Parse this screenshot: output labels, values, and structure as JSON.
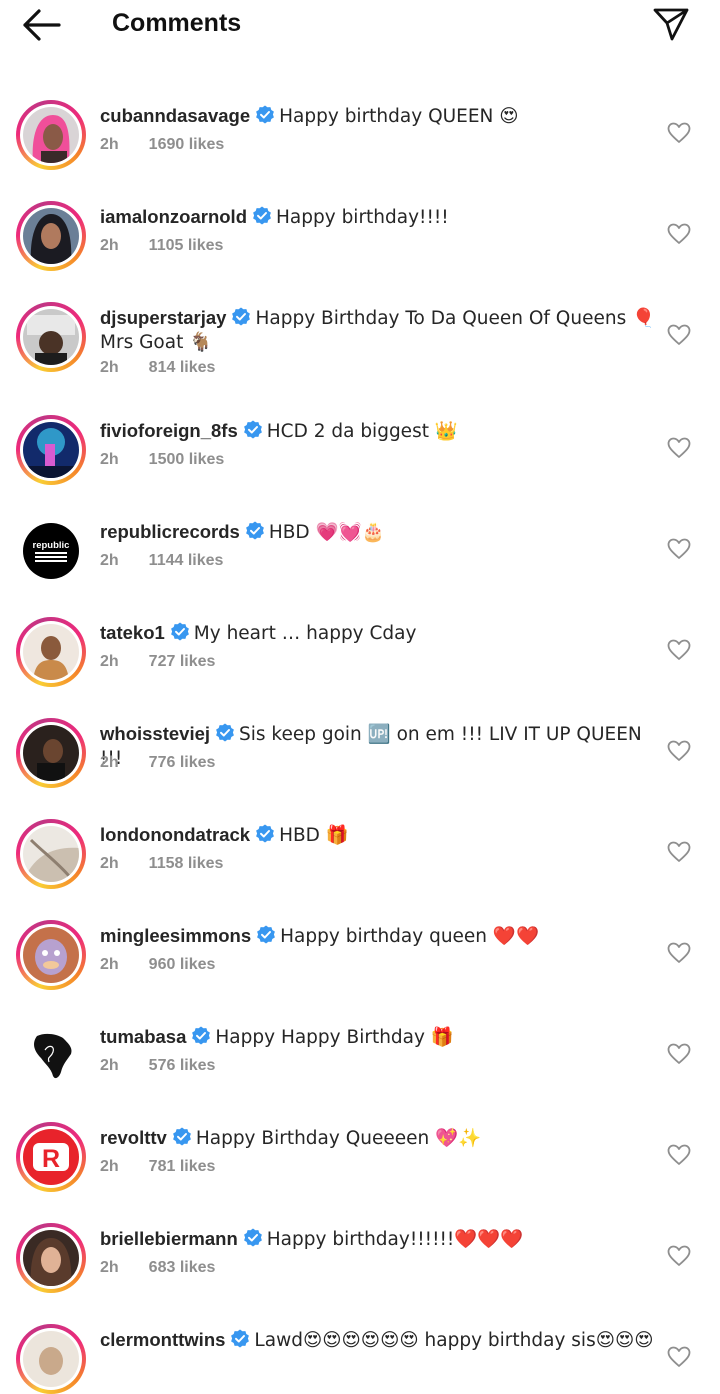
{
  "header": {
    "title": "Comments"
  },
  "comments": [
    {
      "username": "cubanndasavage",
      "text": "Happy birthday QUEEN 😍",
      "time": "2h",
      "likes": "1690 likes"
    },
    {
      "username": "iamalonzoarnold",
      "text": "Happy birthday!!!!",
      "time": "2h",
      "likes": "1105 likes"
    },
    {
      "username": "djsuperstarjay",
      "text": "Happy Birthday To Da Queen Of Queens 🎈 Mrs Goat 🐐",
      "time": "2h",
      "likes": "814 likes"
    },
    {
      "username": "fivioforeign_8fs",
      "text": "HCD 2 da biggest 👑",
      "time": "2h",
      "likes": "1500 likes"
    },
    {
      "username": "republicrecords",
      "text": "HBD 💗💓🎂",
      "time": "2h",
      "likes": "1144 likes"
    },
    {
      "username": "tateko1",
      "text": "My heart … happy Cday",
      "time": "2h",
      "likes": "727 likes"
    },
    {
      "username": "whoissteviej",
      "text": "Sis keep goin 🆙 on em !!! LIV IT UP QUEEN !!!",
      "time": "2h",
      "likes": "776 likes"
    },
    {
      "username": "londonondatrack",
      "text": "HBD 🎁",
      "time": "2h",
      "likes": "1158 likes"
    },
    {
      "username": "mingleesimmons",
      "text": "Happy birthday queen ❤️❤️",
      "time": "2h",
      "likes": "960 likes"
    },
    {
      "username": "tumabasa",
      "text": "Happy Happy Birthday 🎁",
      "time": "2h",
      "likes": "576 likes"
    },
    {
      "username": "revolttv",
      "text": "Happy Birthday Queeeen 💖✨",
      "time": "2h",
      "likes": "781 likes"
    },
    {
      "username": "briellebiermann",
      "text": "Happy birthday!!!!!!❤️❤️❤️",
      "time": "2h",
      "likes": "683 likes"
    },
    {
      "username": "clermonttwins",
      "text": "Lawd😍😍😍😍😍😍 happy birthday sis😍😍😍",
      "time": "",
      "likes": ""
    }
  ],
  "avatars": {
    "republic_text": "republic",
    "revolt_letter": "R"
  },
  "colors": {
    "verified": "#3897f0",
    "meta": "#8e8e8e",
    "text": "#262626",
    "revolt": "#e8232b"
  }
}
